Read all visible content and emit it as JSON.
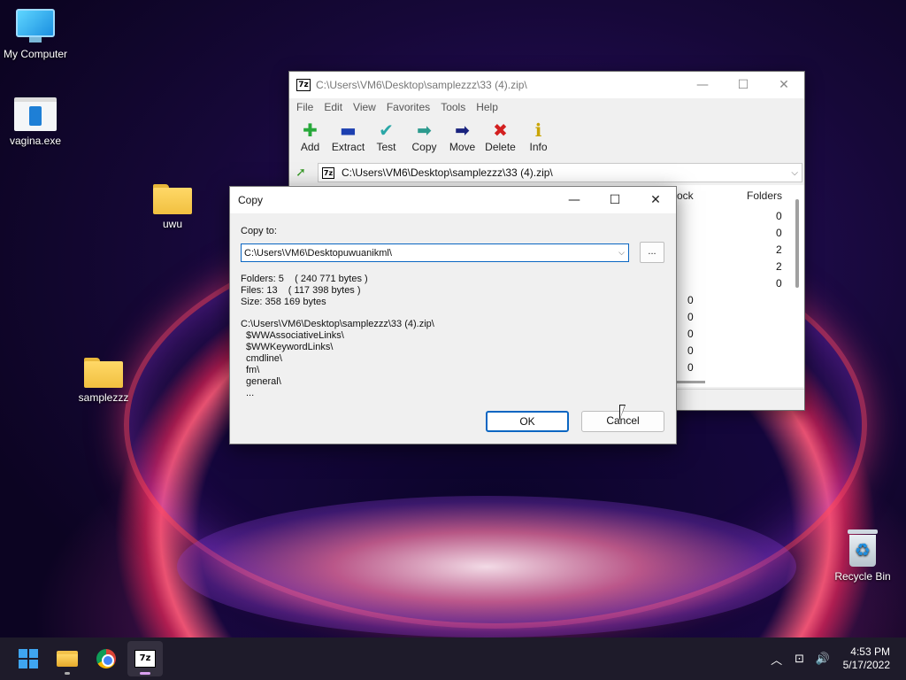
{
  "desktop": {
    "icons": [
      {
        "label": "My Computer"
      },
      {
        "label": "vagina.exe"
      },
      {
        "label": "uwu"
      },
      {
        "label": "samplezzz"
      },
      {
        "label": "Recycle Bin"
      }
    ]
  },
  "zip_window": {
    "app_badge": "7z",
    "title": "C:\\Users\\VM6\\Desktop\\samplezzz\\33 (4).zip\\",
    "controls": {
      "minimize": "—",
      "maximize": "☐",
      "close": "✕"
    },
    "menu": [
      "File",
      "Edit",
      "View",
      "Favorites",
      "Tools",
      "Help"
    ],
    "toolbar": [
      {
        "label": "Add",
        "glyph": "✚",
        "color": "#27a83a"
      },
      {
        "label": "Extract",
        "glyph": "▬",
        "color": "#1c3fb0"
      },
      {
        "label": "Test",
        "glyph": "✔",
        "color": "#2aa7a7"
      },
      {
        "label": "Copy",
        "glyph": "➡",
        "color": "#2c9a8e"
      },
      {
        "label": "Move",
        "glyph": "➡",
        "color": "#1a237e"
      },
      {
        "label": "Delete",
        "glyph": "✖",
        "color": "#d32020"
      },
      {
        "label": "Info",
        "glyph": "ℹ",
        "color": "#c9a400"
      }
    ],
    "address": {
      "up_icon": "➚",
      "path": "C:\\Users\\VM6\\Desktop\\samplezzz\\33 (4).zip\\",
      "arrow": "⌵"
    },
    "list": {
      "col_partial": "ock",
      "col_folders": "Folders",
      "folders_values": [
        "0",
        "0",
        "2",
        "2",
        "0"
      ],
      "partial_values": [
        "0",
        "0",
        "0",
        "0",
        "0"
      ]
    }
  },
  "copy_dialog": {
    "title": "Copy",
    "controls": {
      "minimize": "—",
      "maximize": "☐",
      "close": "✕"
    },
    "copy_to_label": "Copy to:",
    "path_value": "C:\\Users\\VM6\\Desktopuwuanikml\\",
    "combo_arrow": "⌵",
    "browse_label": "...",
    "info": {
      "folders": "Folders: 5    ( 240 771 bytes )",
      "files": "Files: 13    ( 117 398 bytes )",
      "size": "Size: 358 169 bytes"
    },
    "source_path": "C:\\Users\\VM6\\Desktop\\samplezzz\\33 (4).zip\\",
    "items": [
      "$WWAssociativeLinks\\",
      "$WWKeywordLinks\\",
      "cmdline\\",
      "fm\\",
      "general\\",
      "..."
    ],
    "ok_label": "OK",
    "cancel_label": "Cancel"
  },
  "taskbar": {
    "tray_icons": {
      "chevron": "︿",
      "network": "⊡",
      "volume": "🔊"
    },
    "time": "4:53 PM",
    "date": "5/17/2022"
  }
}
